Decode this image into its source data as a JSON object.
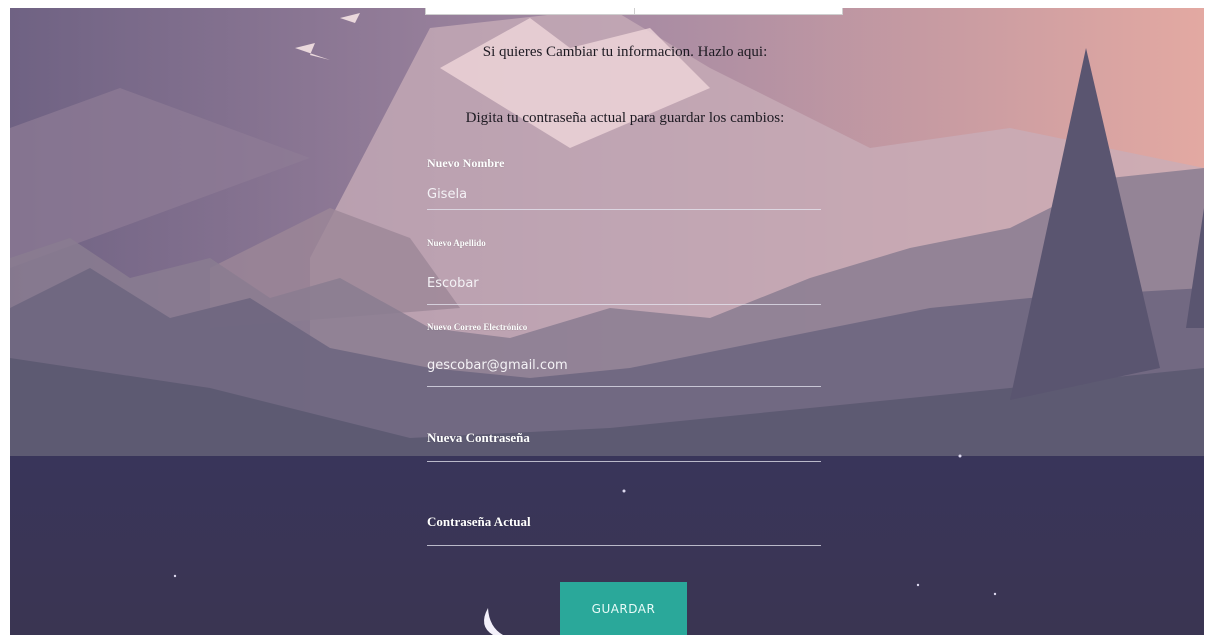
{
  "page": {
    "intro_text": "Si quieres Cambiar tu informacion. Hazlo aqui:",
    "instruction_text": "Digita tu contraseña actual para guardar los cambios:"
  },
  "form": {
    "nombre": {
      "label": "Nuevo Nombre",
      "value": "Gisela"
    },
    "apellido": {
      "label": "Nuevo Apellido",
      "value": "Escobar"
    },
    "correo": {
      "label": "Nuevo Correo Electrónico",
      "value": "gescobar@gmail.com"
    },
    "nueva_contrasena": {
      "label": "Nueva Contraseña",
      "value": ""
    },
    "contrasena_actual": {
      "label": "Contraseña Actual",
      "value": ""
    },
    "submit_label": "GUARDAR"
  },
  "colors": {
    "button": "#2aa89a",
    "night_sky": "#363354",
    "dusk_pink": "#c9a7b1"
  }
}
